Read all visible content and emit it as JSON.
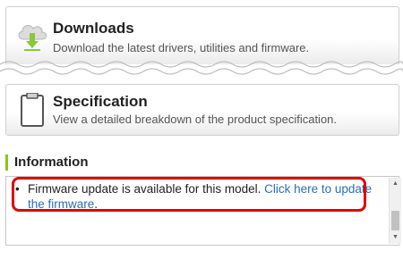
{
  "downloads": {
    "icon": "cloud-download-icon",
    "title": "Downloads",
    "description": "Download the latest drivers, utilities and firmware."
  },
  "specification": {
    "icon": "document-icon",
    "title": "Specification",
    "description": "View a detailed breakdown of the product specification."
  },
  "information": {
    "heading": "Information",
    "items": [
      {
        "bullet": "•",
        "text": "Firmware update is available for this model. ",
        "link": "Click here to update the firmware",
        "suffix": "."
      }
    ]
  },
  "colors": {
    "accent_bar": "#8fc31f",
    "link": "#2a6fb5",
    "highlight": "#e10000"
  }
}
